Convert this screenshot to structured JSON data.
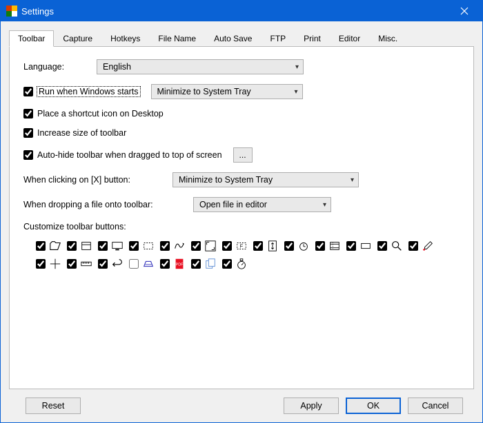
{
  "window": {
    "title": "Settings"
  },
  "tabs": [
    {
      "label": "Toolbar",
      "active": true
    },
    {
      "label": "Capture"
    },
    {
      "label": "Hotkeys"
    },
    {
      "label": "File Name"
    },
    {
      "label": "Auto Save"
    },
    {
      "label": "FTP"
    },
    {
      "label": "Print"
    },
    {
      "label": "Editor"
    },
    {
      "label": "Misc."
    }
  ],
  "panel": {
    "language_label": "Language:",
    "language_value": "English",
    "run_on_start_label": "Run when Windows starts",
    "run_on_start_checked": true,
    "startup_mode_value": "Minimize to System Tray",
    "shortcut_label": "Place a shortcut icon on Desktop",
    "shortcut_checked": true,
    "increase_size_label": "Increase size of toolbar",
    "increase_size_checked": true,
    "autohide_label": "Auto-hide toolbar when dragged to top of screen",
    "autohide_checked": true,
    "ellipsis": "...",
    "close_action_label": "When clicking on [X] button:",
    "close_action_value": "Minimize to System Tray",
    "drop_action_label": "When dropping a file onto toolbar:",
    "drop_action_value": "Open file in editor",
    "customize_label": "Customize toolbar buttons:",
    "toolbar_buttons": [
      {
        "name": "open-folder",
        "checked": true
      },
      {
        "name": "window",
        "checked": true
      },
      {
        "name": "desktop",
        "checked": true
      },
      {
        "name": "region-dashed",
        "checked": true
      },
      {
        "name": "freehand",
        "checked": true
      },
      {
        "name": "fullscreen",
        "checked": true
      },
      {
        "name": "fixed-region",
        "checked": true
      },
      {
        "name": "scrolling",
        "checked": true
      },
      {
        "name": "timer",
        "checked": true
      },
      {
        "name": "video",
        "checked": true
      },
      {
        "name": "rectangle",
        "checked": true
      },
      {
        "name": "magnifier",
        "checked": true
      },
      {
        "name": "color-picker",
        "checked": true
      },
      {
        "name": "crosshair",
        "checked": true
      },
      {
        "name": "ruler",
        "checked": true
      },
      {
        "name": "undo",
        "checked": true
      },
      {
        "name": "scanner",
        "checked": false
      },
      {
        "name": "pdf",
        "checked": true
      },
      {
        "name": "pages",
        "checked": true
      },
      {
        "name": "stopwatch",
        "checked": true
      }
    ]
  },
  "footer": {
    "reset": "Reset",
    "apply": "Apply",
    "ok": "OK",
    "cancel": "Cancel"
  }
}
